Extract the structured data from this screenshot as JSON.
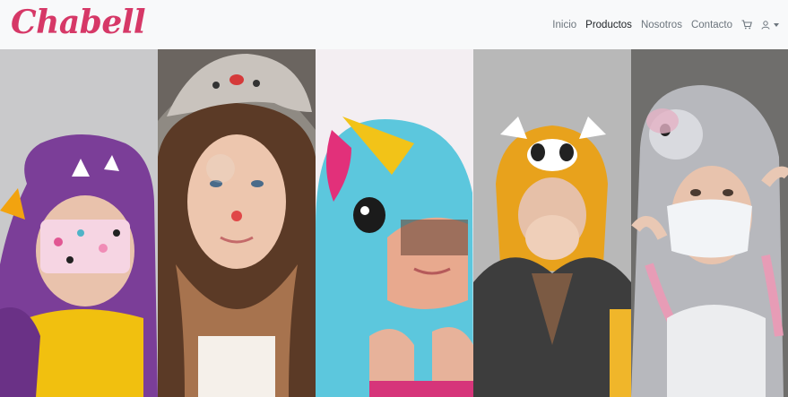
{
  "navbar": {
    "brand": "Chabell",
    "links": [
      {
        "label": "Inicio",
        "active": false
      },
      {
        "label": "Productos",
        "active": true
      },
      {
        "label": "Nosotros",
        "active": false
      },
      {
        "label": "Contacto",
        "active": false
      }
    ],
    "icons": [
      "cart-icon",
      "user-icon"
    ]
  },
  "gallery": {
    "panels": [
      {
        "costume": "purple dragon hood",
        "subject": "child with face mask"
      },
      {
        "costume": "grey reindeer hood",
        "subject": "smiling girl with red nose"
      },
      {
        "costume": "blue unicorn hood",
        "subject": "girl in unicorn hood"
      },
      {
        "costume": "red panda hood",
        "subject": "girl covering face"
      },
      {
        "costume": "grey bunny hood",
        "subject": "girl with face mask"
      }
    ]
  },
  "colors": {
    "brand": "#d63867",
    "navbar_bg": "#f8f9fa",
    "link": "#6c757d",
    "link_active": "#212529"
  }
}
